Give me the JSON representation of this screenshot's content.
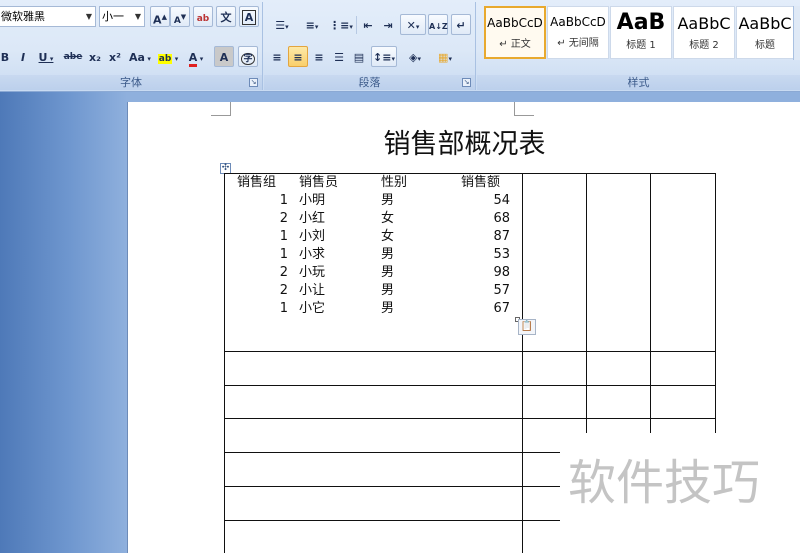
{
  "ribbon": {
    "font_group": {
      "label": "字体",
      "font_name": "微软雅黑",
      "font_size": "小一",
      "grow_font": "A",
      "shrink_font": "A",
      "phonetic": "文",
      "char_border": "A",
      "bold": "B",
      "italic": "I",
      "underline": "U",
      "strikethrough": "abe",
      "subscript": "x₂",
      "superscript": "x²",
      "change_case": "Aa",
      "highlight": "ab",
      "font_color": "A",
      "char_shading": "A",
      "enclose": "字"
    },
    "paragraph_group": {
      "label": "段落"
    },
    "styles_group": {
      "label": "样式",
      "tiles": [
        {
          "sample": "AaBbCcD",
          "name": "↵ 正文"
        },
        {
          "sample": "AaBbCcD",
          "name": "↵ 无间隔"
        },
        {
          "sample": "AaB",
          "name": "标题 1"
        },
        {
          "sample": "AaBbC",
          "name": "标题 2"
        },
        {
          "sample": "AaBbC",
          "name": "标题"
        }
      ]
    }
  },
  "document": {
    "title": "销售部概况表",
    "headers": [
      "销售组",
      "销售员",
      "性别",
      "销售额"
    ],
    "rows": [
      {
        "group": "1",
        "person": "小明",
        "gender": "男",
        "amount": "54"
      },
      {
        "group": "2",
        "person": "小红",
        "gender": "女",
        "amount": "68"
      },
      {
        "group": "1",
        "person": "小刘",
        "gender": "女",
        "amount": "87"
      },
      {
        "group": "1",
        "person": "小求",
        "gender": "男",
        "amount": "53"
      },
      {
        "group": "2",
        "person": "小玩",
        "gender": "男",
        "amount": "98"
      },
      {
        "group": "2",
        "person": "小让",
        "gender": "男",
        "amount": "57"
      },
      {
        "group": "1",
        "person": "小它",
        "gender": "男",
        "amount": "67"
      }
    ]
  },
  "watermark": "软件技巧",
  "colors": {
    "ribbon_bg": "#dce8f7",
    "workspace_blue": "#6f97cf",
    "selected_style_border": "#e8a92e"
  }
}
